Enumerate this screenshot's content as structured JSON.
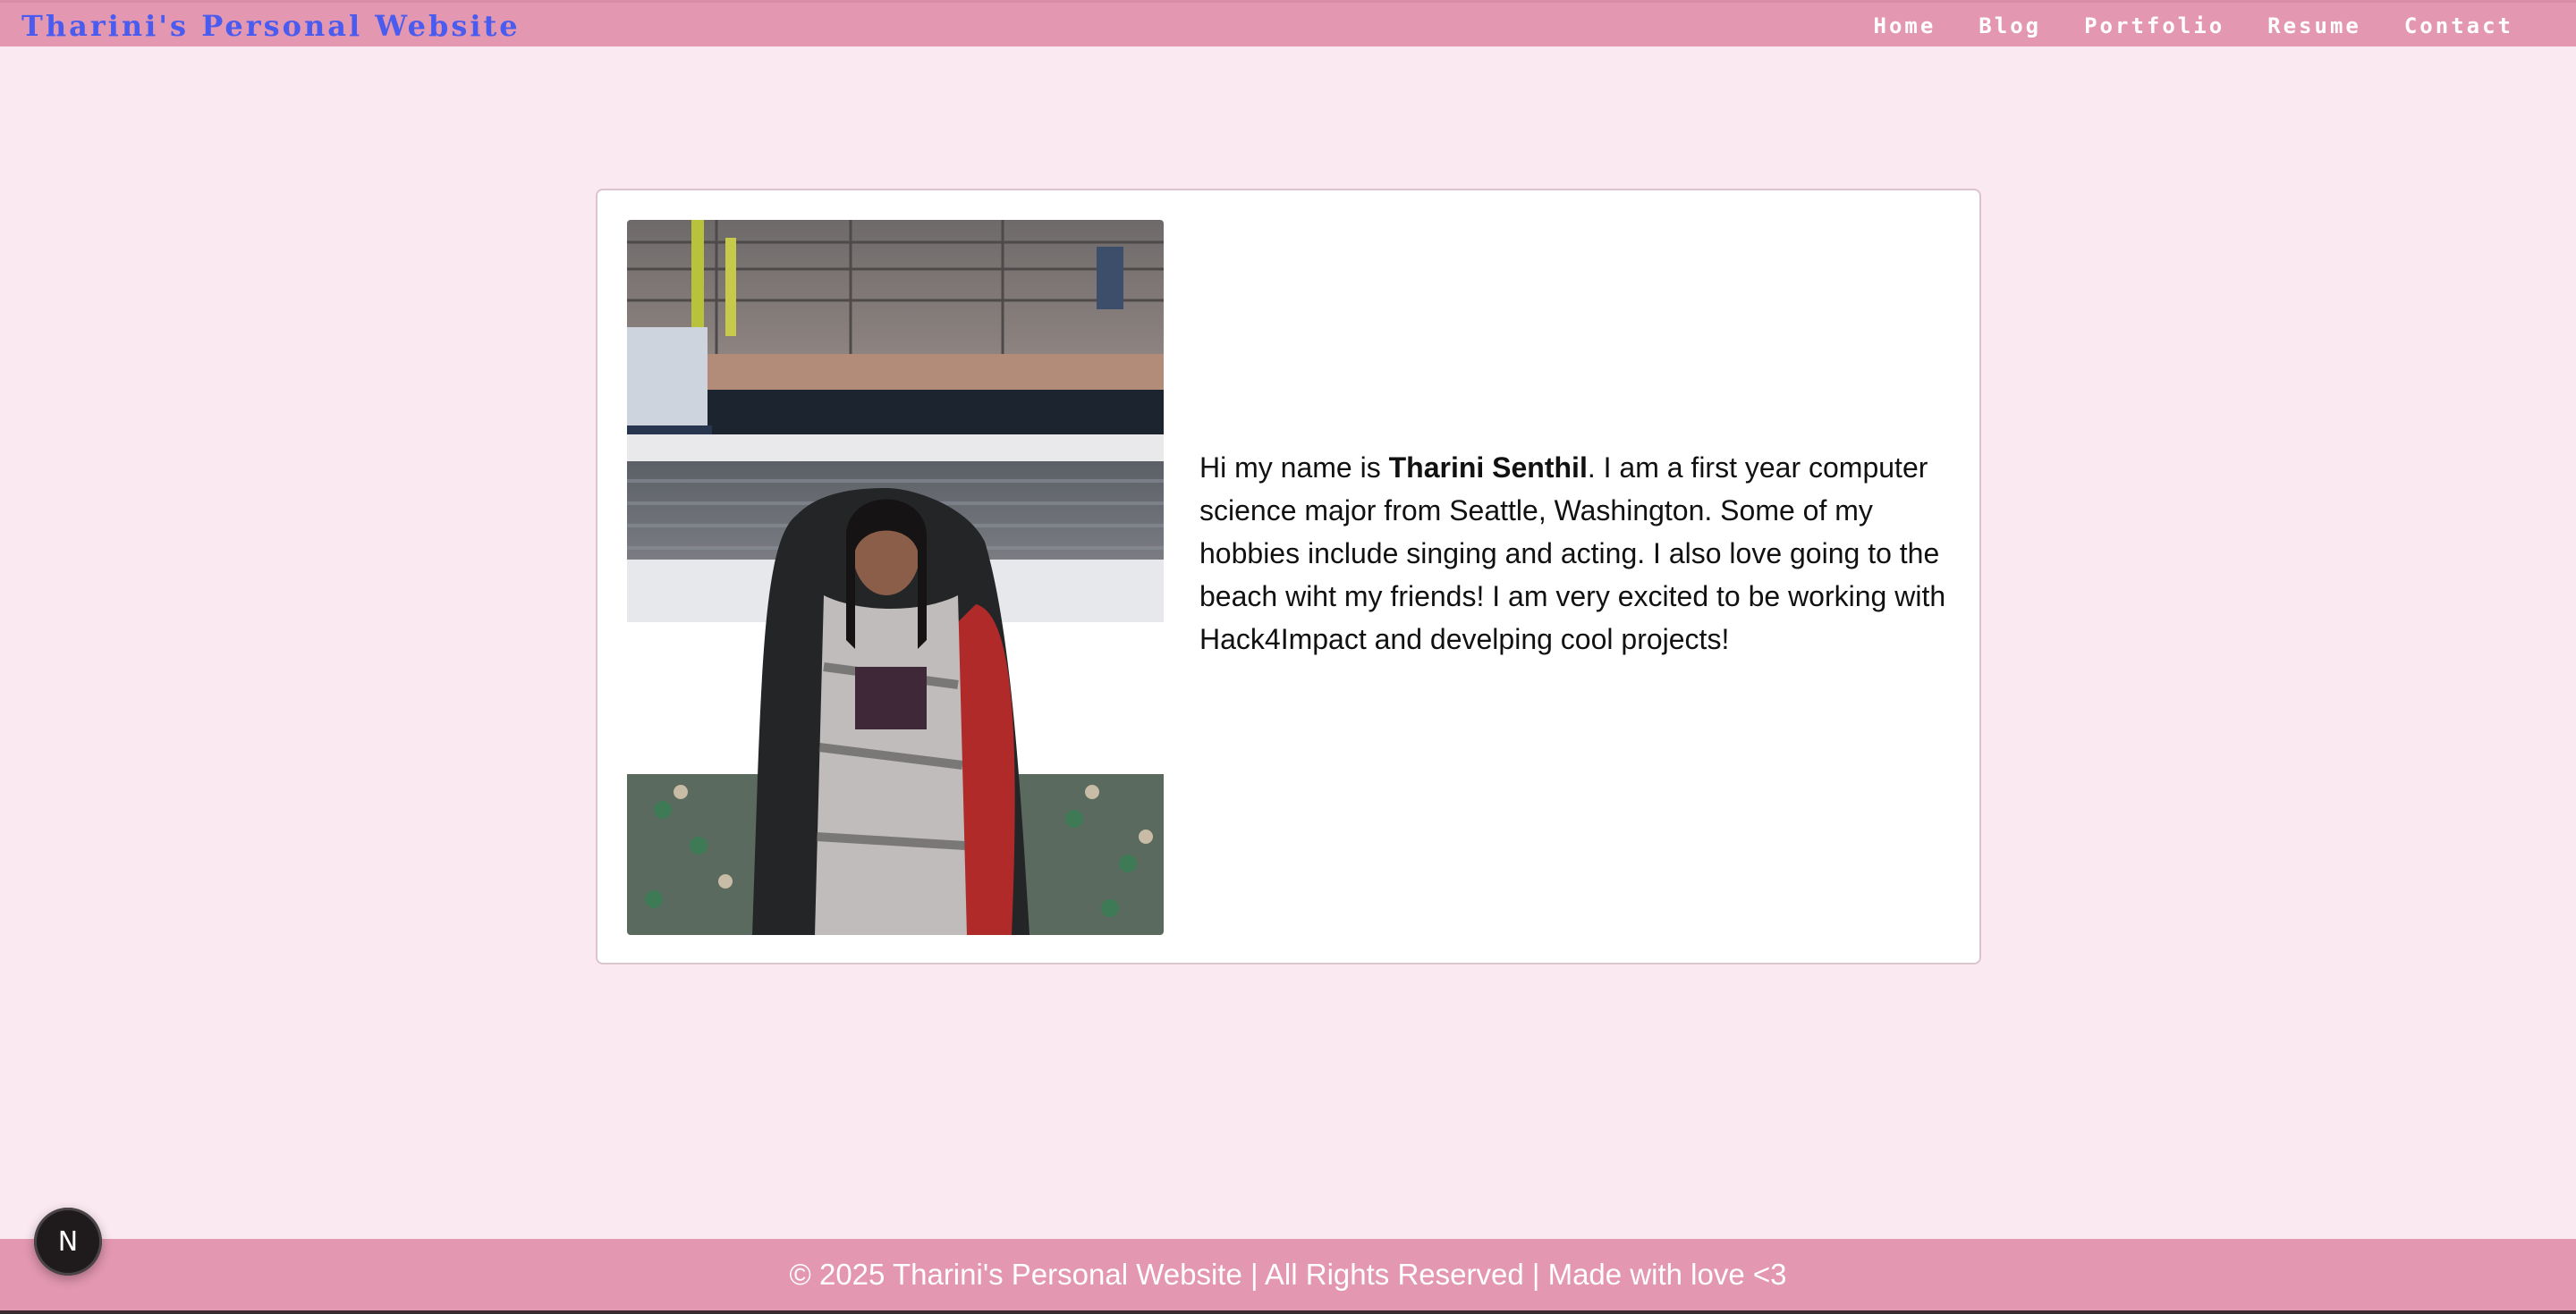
{
  "header": {
    "title": "Tharini's Personal Website",
    "nav": [
      {
        "label": "Home"
      },
      {
        "label": "Blog"
      },
      {
        "label": "Portfolio"
      },
      {
        "label": "Resume"
      },
      {
        "label": "Contact"
      }
    ]
  },
  "bio": {
    "intro": "Hi my name is ",
    "name": "Tharini Senthil",
    "rest": ". I am a first year computer science major from Seattle, Washington. Some of my hobbies include singing and acting. I also love going to the beach wiht my friends! I am very excited to be working with Hack4Impact and develping cool projects!"
  },
  "footer": {
    "text": "© 2025 Tharini's Personal Website | All Rights Reserved | Made with love <3"
  },
  "badge": {
    "label": "N",
    "icon": "nextjs-logo-icon"
  },
  "colors": {
    "page_bg": "#fbe9f2",
    "header_bg": "#e397b1",
    "title": "#4a5cf0"
  }
}
